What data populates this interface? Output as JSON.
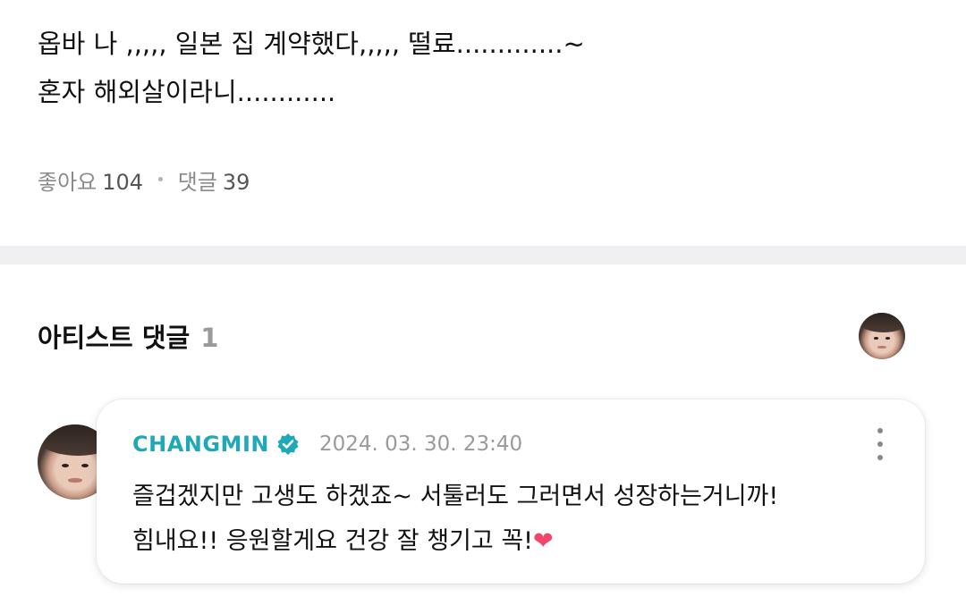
{
  "post": {
    "lines": [
      "옵바 나 ,,,,, 일본 집 계약했다,,,,, 떨료.............~",
      "혼자 해외살이라니............"
    ],
    "likes_label": "좋아요",
    "likes_count": "104",
    "comments_label": "댓글",
    "comments_count": "39"
  },
  "artist_comments": {
    "title": "아티스트 댓글",
    "count": "1"
  },
  "comment": {
    "author": "CHANGMIN",
    "timestamp": "2024. 03. 30. 23:40",
    "lines": [
      "즐겁겠지만 고생도 하겠죠~ 서툴러도 그러면서 성장하는거니까!",
      "힘내요!! 응원할게요 건강 잘 챙기고 꼭!"
    ],
    "emoji": "❤"
  },
  "colors": {
    "author": "#1fa8b8",
    "heart": "#f2456a",
    "divider": "#f0f0f2"
  },
  "icons": [
    "verified-badge-icon",
    "more-vertical-icon"
  ]
}
